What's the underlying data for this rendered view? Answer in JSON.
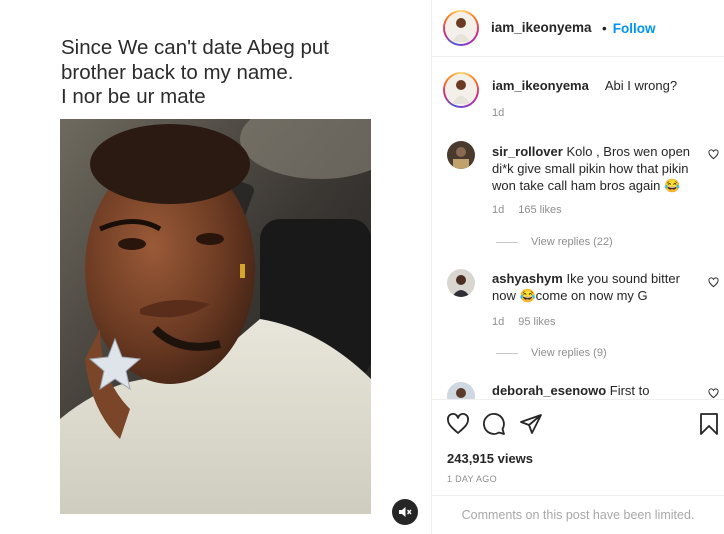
{
  "post": {
    "caption": "Since We can't date Abeg put\nbrother back to my name.\nI nor be ur mate"
  },
  "header": {
    "username": "iam_ikeonyema",
    "follow_dot": "•",
    "follow_label": "Follow"
  },
  "author_comment": {
    "username": "iam_ikeonyema",
    "text": "Abi I wrong?",
    "time": "1d"
  },
  "comments": [
    {
      "username": "sir_rollover",
      "text": "Kolo , Bros wen open di*k give small pikin how that pikin won take call ham bros again 😂",
      "time": "1d",
      "likes": "165 likes",
      "replies": "View replies (22)"
    },
    {
      "username": "ashyashym",
      "text": "Ike you sound bitter now 😂come on now my G",
      "time": "1d",
      "likes": "95 likes",
      "replies": "View replies (9)"
    },
    {
      "username": "deborah_esenowo",
      "text": "First to"
    }
  ],
  "stats": {
    "views": "243,915 views",
    "time": "1 DAY AGO"
  },
  "footer": {
    "limited": "Comments on this post have been limited."
  },
  "colors": {
    "accent": "#0095f6",
    "muted": "#8e8e8e"
  }
}
